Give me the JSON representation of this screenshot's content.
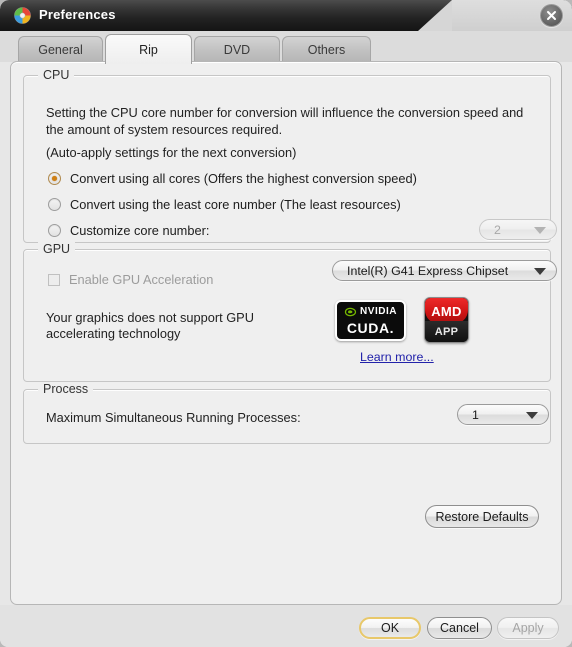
{
  "window": {
    "title": "Preferences",
    "app_icon": "disc-icon",
    "close_icon": "close-icon"
  },
  "tabs": [
    {
      "label": "General",
      "active": false
    },
    {
      "label": "Rip",
      "active": true
    },
    {
      "label": "DVD",
      "active": false
    },
    {
      "label": "Others",
      "active": false
    }
  ],
  "cpu": {
    "group_title": "CPU",
    "description": "Setting the CPU core number for conversion will influence the conversion speed and the amount of system resources required.",
    "auto_apply_note": "(Auto-apply settings for the next conversion)",
    "options": [
      {
        "label": "Convert using all cores (Offers the highest conversion speed)",
        "selected": true
      },
      {
        "label": "Convert using the least core number (The least resources)",
        "selected": false
      },
      {
        "label": "Customize core number:",
        "selected": false
      }
    ],
    "core_number_value": "2",
    "core_number_enabled": false
  },
  "gpu": {
    "group_title": "GPU",
    "enable_label": "Enable GPU Acceleration",
    "enable_checked": false,
    "enable_disabled": true,
    "device_value": "Intel(R) G41 Express Chipset",
    "unsupported_note": "Your graphics does not support GPU accelerating technology",
    "logos": {
      "nvidia_brand": "NVIDIA",
      "nvidia_product": "CUDA.",
      "amd_brand": "AMD",
      "amd_product": "APP"
    },
    "learn_more_label": "Learn more...",
    "learn_more_color": "#2222aa"
  },
  "process": {
    "group_title": "Process",
    "label": "Maximum Simultaneous Running Processes:",
    "value": "1"
  },
  "buttons": {
    "restore_defaults": "Restore Defaults",
    "ok": "OK",
    "cancel": "Cancel",
    "apply": "Apply",
    "apply_disabled": true,
    "ok_focus_color": "#e8c86a"
  },
  "colors": {
    "radio_accent": "#d08014",
    "title_bar": "#1a1a1a",
    "panel_bg": "#efefef"
  }
}
